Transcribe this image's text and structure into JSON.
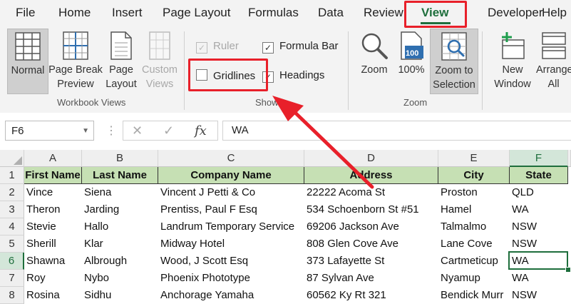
{
  "menu_tabs": [
    "File",
    "Home",
    "Insert",
    "Page Layout",
    "Formulas",
    "Data",
    "Review",
    "View",
    "Developer",
    "Help"
  ],
  "active_tab": "View",
  "ribbon": {
    "workbook_views": {
      "label": "Workbook Views",
      "normal": "Normal",
      "page_break": [
        "Page Break",
        "Preview"
      ],
      "page_layout": [
        "Page",
        "Layout"
      ],
      "custom_views": [
        "Custom",
        "Views"
      ]
    },
    "show": {
      "label": "Show",
      "ruler": "Ruler",
      "formula_bar": "Formula Bar",
      "gridlines": "Gridlines",
      "headings": "Headings",
      "ruler_checked": true,
      "formula_bar_checked": true,
      "gridlines_checked": false,
      "headings_checked": true
    },
    "zoom": {
      "label": "Zoom",
      "zoom": "Zoom",
      "hundred": "100%",
      "hundred_icon": "100",
      "zoom_selection": [
        "Zoom to",
        "Selection"
      ]
    },
    "window": {
      "new_window": [
        "New",
        "Window"
      ],
      "arrange_all": [
        "Arrange",
        "All"
      ]
    }
  },
  "formula_bar": {
    "name_box": "F6",
    "content": "WA",
    "cancel_icon": "✕",
    "enter_icon": "✓",
    "fx_icon": "fx"
  },
  "sheet": {
    "columns": [
      "A",
      "B",
      "C",
      "D",
      "E",
      "F"
    ],
    "selected_column": "F",
    "selected_row": "6",
    "headers": [
      "First Name",
      "Last Name",
      "Company Name",
      "Address",
      "City",
      "State"
    ],
    "rows": [
      {
        "num": "2",
        "cells": [
          "Vince",
          "Siena",
          "Vincent J Petti & Co",
          "22222 Acoma St",
          "Proston",
          "QLD"
        ]
      },
      {
        "num": "3",
        "cells": [
          "Theron",
          "Jarding",
          "Prentiss, Paul F Esq",
          "534 Schoenborn St #51",
          "Hamel",
          "WA"
        ]
      },
      {
        "num": "4",
        "cells": [
          "Stevie",
          "Hallo",
          "Landrum Temporary Service",
          "69206 Jackson Ave",
          "Talmalmo",
          "NSW"
        ]
      },
      {
        "num": "5",
        "cells": [
          "Sherill",
          "Klar",
          "Midway Hotel",
          "808 Glen Cove Ave",
          "Lane Cove",
          "NSW"
        ]
      },
      {
        "num": "6",
        "cells": [
          "Shawna",
          "Albrough",
          "Wood, J Scott Esq",
          "373 Lafayette St",
          "Cartmeticup",
          "WA"
        ]
      },
      {
        "num": "7",
        "cells": [
          "Roy",
          "Nybo",
          "Phoenix Phototype",
          "87 Sylvan Ave",
          "Nyamup",
          "WA"
        ]
      },
      {
        "num": "8",
        "cells": [
          "Rosina",
          "Sidhu",
          "Anchorage Yamaha",
          "60562 Ky Rt 321",
          "Bendick Murr",
          "NSW"
        ]
      }
    ]
  },
  "colors": {
    "accent": "#1e6e3c",
    "header_fill": "#c6e0b4",
    "callout": "#e8202a"
  }
}
